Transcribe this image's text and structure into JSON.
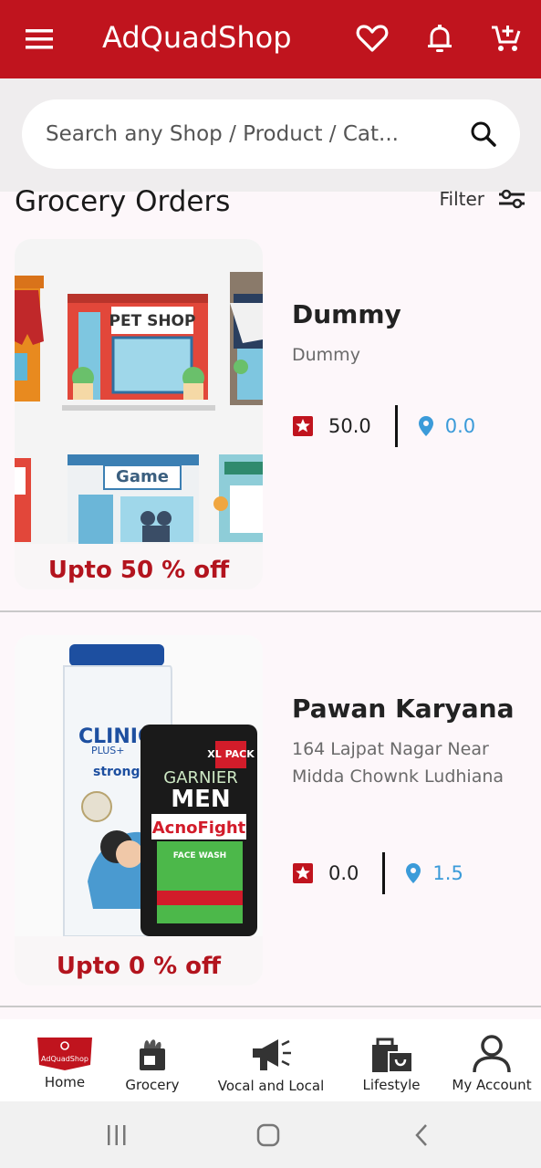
{
  "app": {
    "title": "AdQuadShop"
  },
  "search": {
    "placeholder": "Search any Shop / Product / Cat..."
  },
  "section": {
    "title": "Grocery Orders",
    "filter_label": "Filter"
  },
  "shops": [
    {
      "name": "Dummy",
      "address": "Dummy",
      "rating": "50.0",
      "distance": "0.0",
      "offer": "Upto 50 % off",
      "sign_1": "PET SHOP",
      "sign_2": "Game"
    },
    {
      "name": "Pawan Karyana",
      "address": "164 Lajpat Nagar Near Midda Chownk Ludhiana",
      "rating": "0.0",
      "distance": "1.5",
      "offer": "Upto 0 % off",
      "bottle_brand": "CLINIC",
      "bottle_sub": "PLUS+",
      "bottle_text": "strong & long",
      "tube_badge": "XL PACK",
      "tube_brand": "GARNIER",
      "tube_men": "MEN",
      "tube_name": "AcnoFight",
      "tube_sub": "FACE WASH"
    }
  ],
  "bottom_nav": {
    "logo_text": "AdQuadShop",
    "items": [
      {
        "label": "Home",
        "icon": "home-logo-icon"
      },
      {
        "label": "Grocery",
        "icon": "grocery-bag-icon"
      },
      {
        "label": "Vocal and Local",
        "icon": "megaphone-icon"
      },
      {
        "label": "Lifestyle",
        "icon": "shopping-bag-icon"
      },
      {
        "label": "My Account",
        "icon": "person-icon"
      }
    ]
  },
  "colors": {
    "brand": "#c0141e",
    "offer": "#b3141e",
    "distance": "#3b9bd9"
  }
}
